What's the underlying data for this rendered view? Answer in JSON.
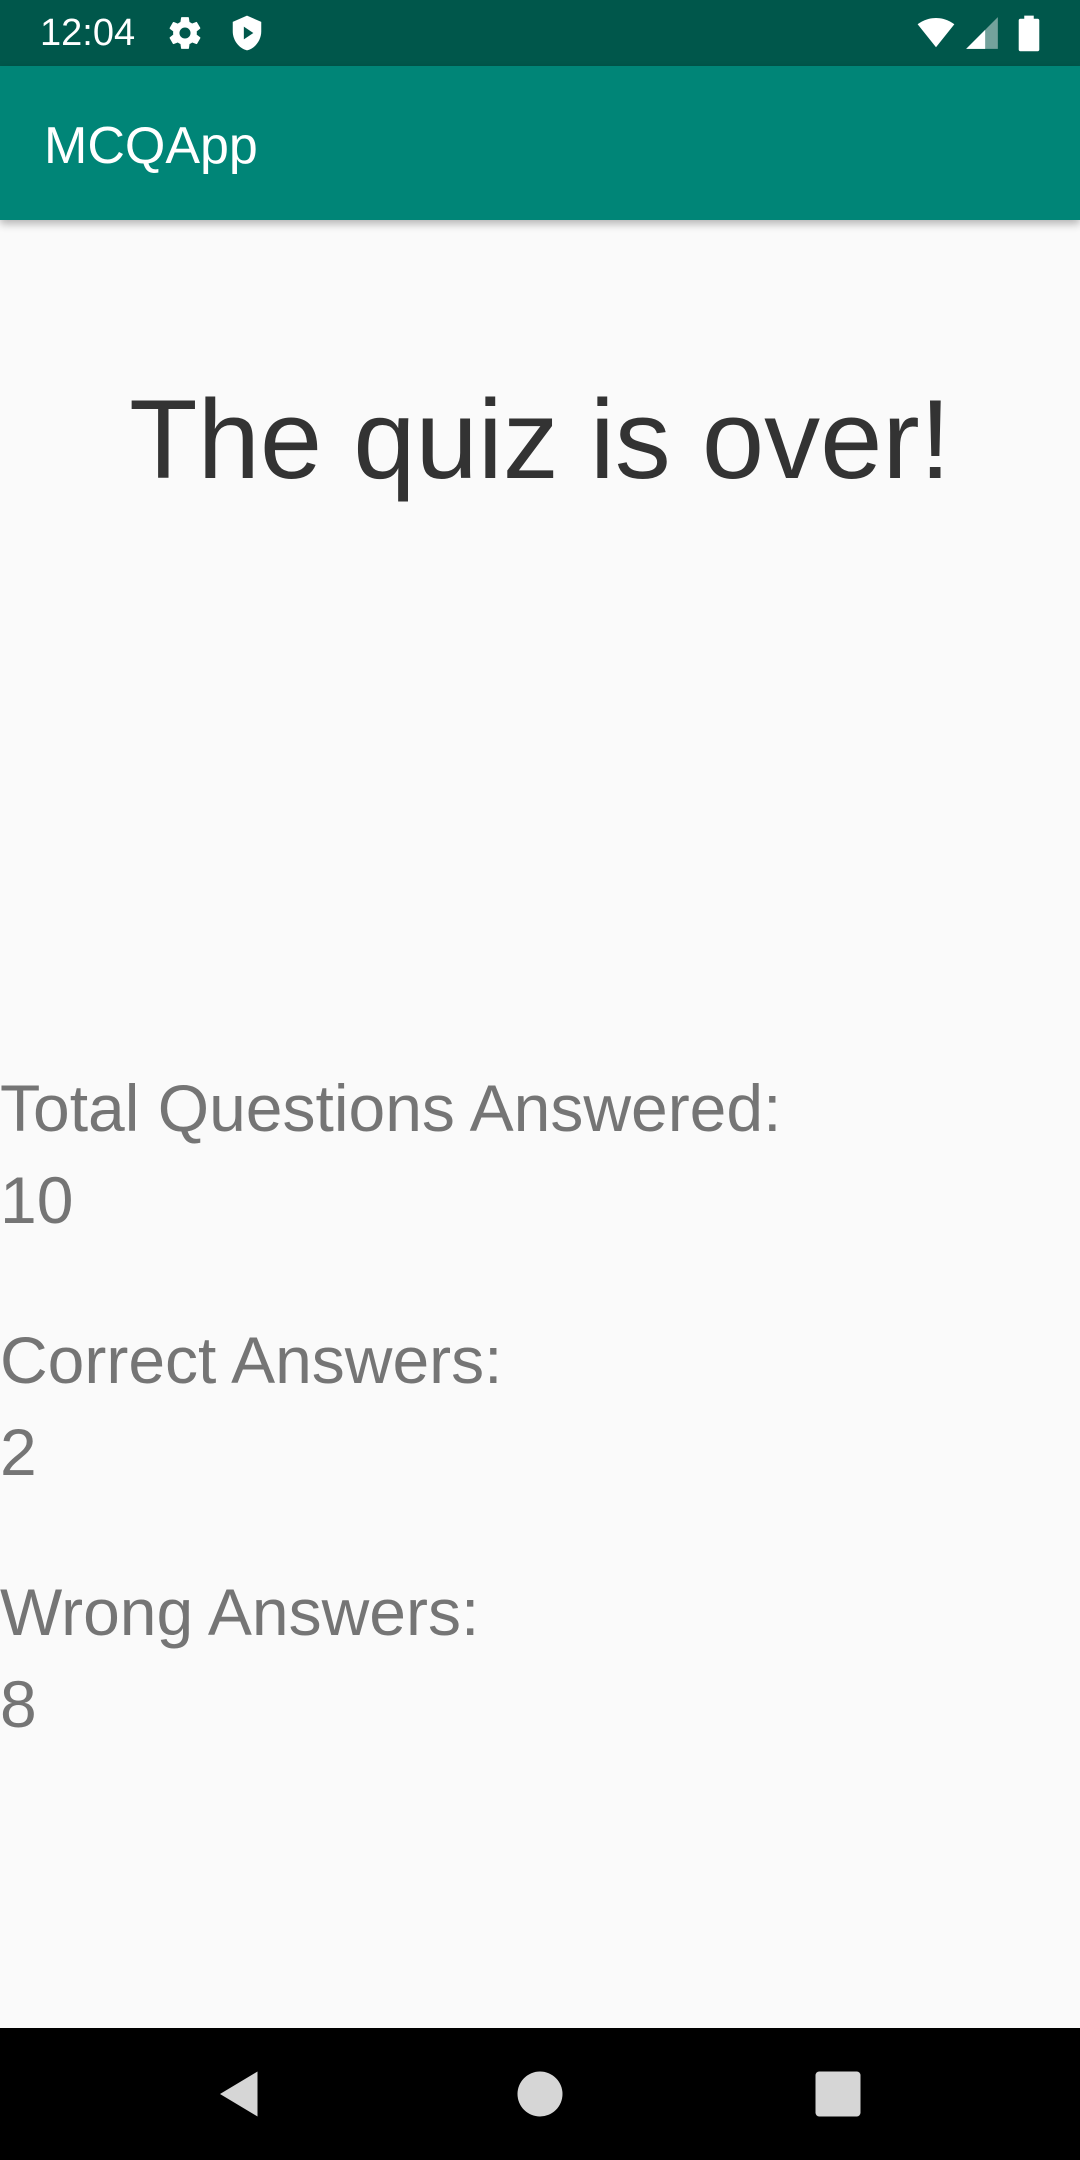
{
  "status_bar": {
    "time": "12:04",
    "background_color": "#00574b",
    "left_icons": [
      "gear-icon",
      "shield-play-icon"
    ],
    "right_icons": [
      "wifi-icon",
      "cellular-signal-icon",
      "battery-icon"
    ]
  },
  "app_bar": {
    "title": "MCQApp",
    "background_color": "#008577"
  },
  "main": {
    "headline": "The quiz is over!",
    "stats": {
      "total_label": "Total Questions Answered:",
      "total_value": "10",
      "correct_label": "Correct Answers:",
      "correct_value": "2",
      "wrong_label": "Wrong Answers:",
      "wrong_value": "8"
    }
  },
  "nav_bar": {
    "buttons": [
      "back-icon",
      "home-icon",
      "recents-icon"
    ]
  }
}
